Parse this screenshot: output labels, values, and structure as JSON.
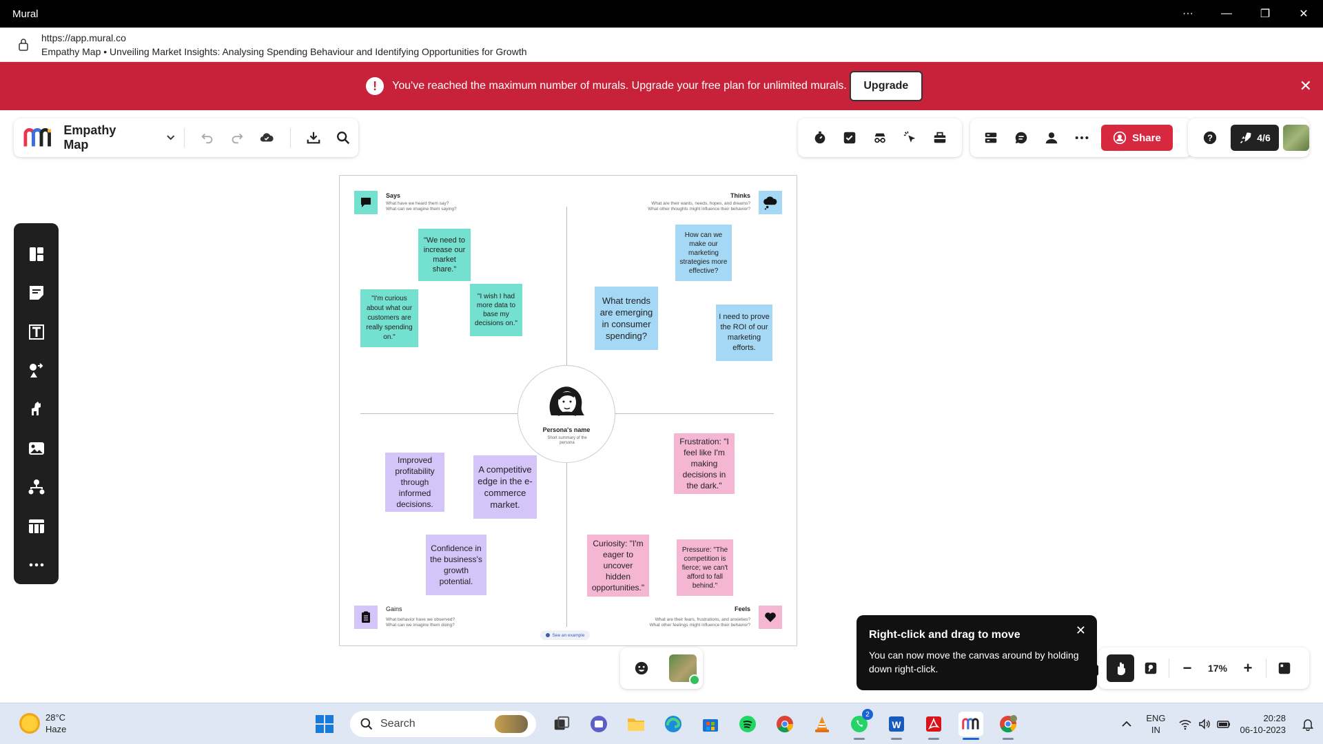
{
  "window": {
    "title": "Mural",
    "controls": [
      "···",
      "—",
      "❐",
      "✕"
    ]
  },
  "address": {
    "url": "https://app.mural.co",
    "page_title": "Empathy Map • Unveiling Market Insights: Analysing Spending Behaviour and Identifying Opportunities for Growth"
  },
  "banner": {
    "message": "You've reached the maximum number of murals. Upgrade your free plan for unlimited murals.",
    "upgrade_label": "Upgrade",
    "close": "✕",
    "color": "#c8223a"
  },
  "toolbar": {
    "board_title": "Empathy Map",
    "share_label": "Share",
    "collab_count": "4/6",
    "share_color": "#d8283f"
  },
  "board": {
    "says": {
      "title": "Says",
      "sub1": "What have we heard them say?",
      "sub2": "What can we imagine them saying?"
    },
    "thinks": {
      "title": "Thinks",
      "sub1": "What are their wants, needs, hopes, and dreams?",
      "sub2": "What other thoughts might influence their behavior?"
    },
    "gains": {
      "title": "Gains",
      "sub1": "What behavior have we observed?",
      "sub2": "What can we imagine them doing?"
    },
    "feels": {
      "title": "Feels",
      "sub1": "What are their fears, frustrations, and anxieties?",
      "sub2": "What other feelings might influence their behavior?"
    },
    "persona": {
      "name": "Persona's name",
      "summary": "Short summary of the persona"
    },
    "example_label": "See an example",
    "notes": {
      "t1": "\"We need to increase our market share.\"",
      "t2": "\"I'm curious about what our customers are really spending on.\"",
      "t3": "\"I wish I had more data to base my decisions on.\"",
      "b1": "How can we make our marketing strategies more effective?",
      "b2": "What trends are emerging in consumer spending?",
      "b3": "I need to prove the ROI of our marketing efforts.",
      "p1": "Improved profitability through informed decisions.",
      "p2": "A competitive edge in the e-commerce market.",
      "p3": "Confidence in the business's growth potential.",
      "k1": "Frustration: \"I feel like I'm making decisions in the dark.\"",
      "k2": "Curiosity: \"I'm eager to uncover hidden opportunities.\"",
      "k3": "Pressure: \"The competition is fierce; we can't afford to fall behind.\""
    }
  },
  "tooltip": {
    "title": "Right-click and drag to move",
    "body": "You can now move the canvas around by holding down right-click.",
    "close": "✕"
  },
  "zoom": {
    "level": "17%",
    "minus": "−",
    "plus": "+"
  },
  "taskbar": {
    "weather_temp": "28°C",
    "weather_desc": "Haze",
    "search_label": "Search",
    "whatsapp_badge": "2",
    "lang_line1": "ENG",
    "lang_line2": "IN",
    "time": "20:28",
    "date": "06-10-2023"
  }
}
